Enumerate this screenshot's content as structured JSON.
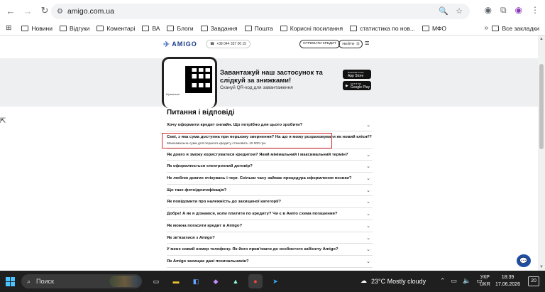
{
  "browser": {
    "url": "amigo.com.ua",
    "bookmarks": [
      "Новини",
      "Відгуки",
      "Коментарі",
      "ВА",
      "Блоги",
      "Завдання",
      "Пошта",
      "Корисні посилання",
      "статистика по нов...",
      "МФО"
    ],
    "all_bookmarks": "Все закладки",
    "more": "»"
  },
  "site": {
    "logo": "AMIGO",
    "phone": "+38 044 337 00 15",
    "credit_button": "ОТРИМАТИ КРЕДИТ",
    "login_button": "УВІЙТИ"
  },
  "banner": {
    "title": "Завантажуй наш застосунок та слідкуй за знижками!",
    "subtitle": "Скануй QR-код для завантаження",
    "app_store": "App Store",
    "app_store_pre": "Download on the",
    "google_play": "Google Play",
    "google_play_pre": "GET IT ON",
    "phone_label": "Щомісячні"
  },
  "faq": {
    "title": "Питання і відповіді",
    "items": [
      {
        "q": "Хочу оформити кредит онлайн. Що потрібно для цього зробити?",
        "open": false
      },
      {
        "q": "Севі, з яка сума доступна при першому звернення? На що я можу розраховувати як новий клієнт?",
        "open": true,
        "a": "Максимальна сума для першого кредиту становить 10 000 грн."
      },
      {
        "q": "Як довго я зможу користуватися кредитом? Який мінімальний і максимальний термін?",
        "open": false
      },
      {
        "q": "Як оформлюється електронний договір?",
        "open": false
      },
      {
        "q": "Не люблю довгих очікувань і черг. Скільки часу займає процедура оформлення позики?",
        "open": false
      },
      {
        "q": "Що таке фотоідентифікація?",
        "open": false
      },
      {
        "q": "Як повідомити про належність до захищеної категорії?",
        "open": false
      },
      {
        "q": "Добре! А як я дізнаюся, коли платити по кредиту? Чи є в Аміго схема погашення?",
        "open": false
      },
      {
        "q": "Як можна погасити кредит в Amigo?",
        "open": false
      },
      {
        "q": "Як зв'язатися з Amigo?",
        "open": false
      },
      {
        "q": "У мене новий номер телефону. Як його прив'язати до особистого кабінету Amigo?",
        "open": false
      },
      {
        "q": "Як Amigo захищає дані позичальників?",
        "open": false
      },
      {
        "q": "Які картки приймаються для оформлення кредиту?",
        "open": false
      }
    ]
  },
  "taskbar": {
    "search": "Поиск",
    "weather": "23°C  Mostly cloudy",
    "lang_top": "УКР",
    "lang_bottom": "UKR",
    "time": "18:39",
    "date": "17.06.2026",
    "notifications": "20"
  },
  "icons": [
    "back-icon",
    "forward-icon",
    "reload-icon",
    "site-info-icon",
    "zoom-icon",
    "star-icon",
    "camera-icon",
    "extensions-icon",
    "profile-icon",
    "menu-icon",
    "apps-icon",
    "folder-icon",
    "phone-icon",
    "hamburger-icon",
    "chevron-down-icon",
    "chevron-up-icon",
    "chat-icon",
    "windows-icon",
    "search-icon"
  ]
}
